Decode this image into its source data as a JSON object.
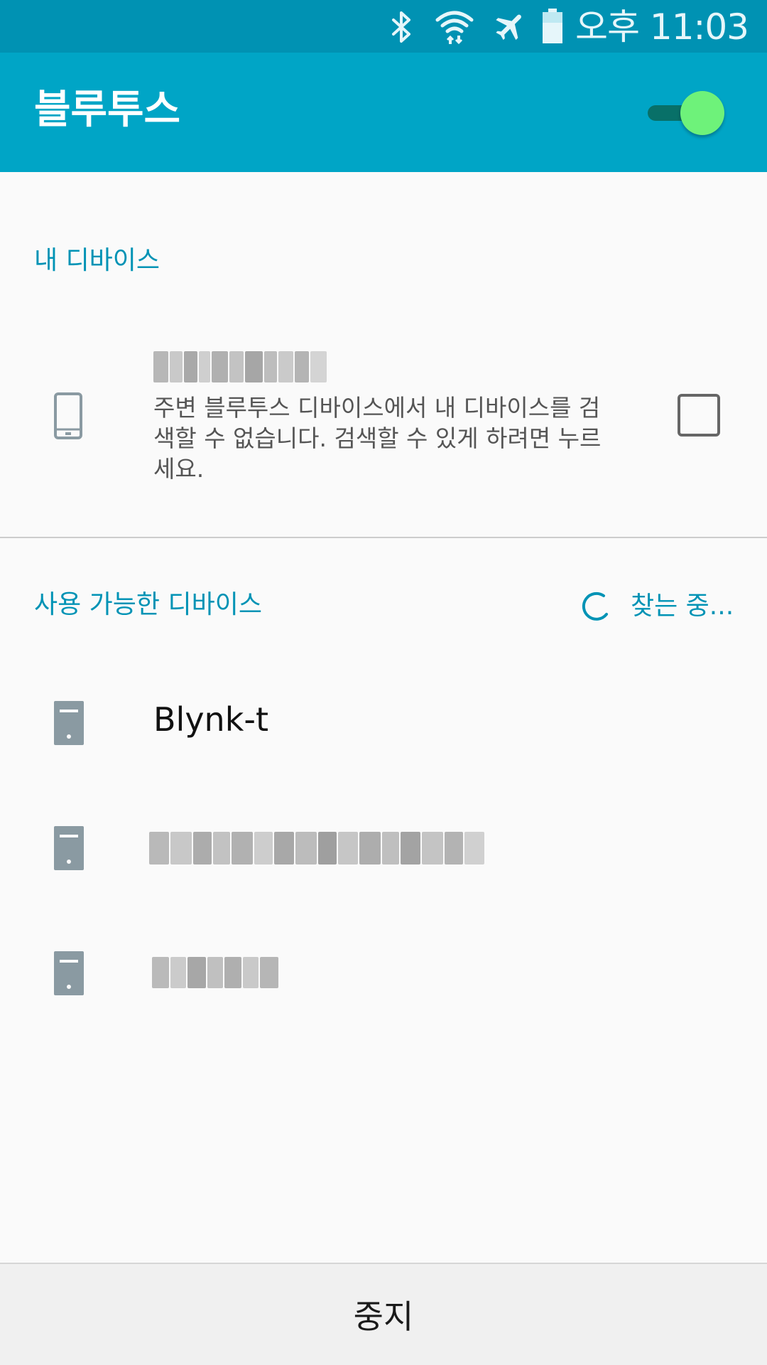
{
  "status_bar": {
    "icons": [
      "bluetooth-icon",
      "wifi-icon",
      "airplane-mode-icon",
      "battery-icon"
    ],
    "time": "오후 11:03"
  },
  "app_bar": {
    "title": "블루투스",
    "bluetooth_toggle": {
      "state": "on",
      "track_color": "#087068",
      "thumb_color": "#6ef27a"
    },
    "background": "#00a5c6"
  },
  "my_devices": {
    "header": "내 디바이스",
    "device": {
      "icon": "phone-icon",
      "name_blurred": true,
      "description": "주변 블루투스 디바이스에서 내 디바이스를 검색할 수 없습니다. 검색할 수 있게 하려면 누르세요.",
      "visible_checkbox_checked": false
    }
  },
  "available_devices": {
    "header": "사용 가능한 디바이스",
    "scanning_label": "찾는 중...",
    "devices": [
      {
        "name": "Blynk-t",
        "blurred": false,
        "icon": "device-icon"
      },
      {
        "name": "",
        "blurred": true,
        "icon": "device-icon"
      },
      {
        "name": "",
        "blurred": true,
        "icon": "device-icon"
      }
    ]
  },
  "bottom_bar": {
    "stop_label": "중지"
  },
  "colors": {
    "status_bar": "#0092b3",
    "accent": "#0093b5",
    "background": "#fafafa"
  }
}
